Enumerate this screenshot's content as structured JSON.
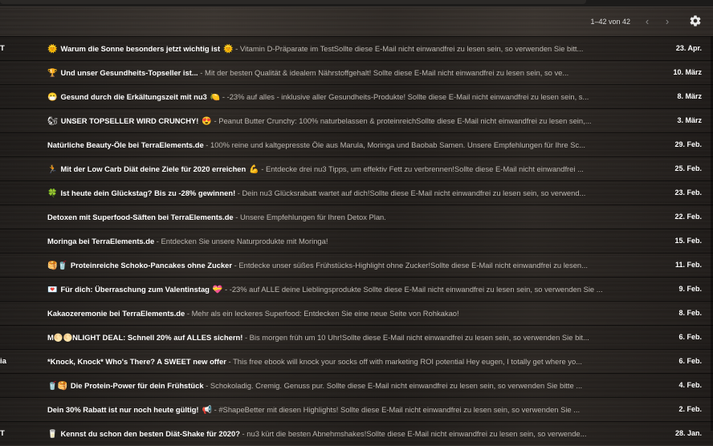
{
  "toolbar": {
    "pager": "1–42 von 42",
    "prev_icon": "chevron-left-icon",
    "next_icon": "chevron-right-icon",
    "settings_icon": "gear-icon"
  },
  "emails": [
    {
      "sender": "T",
      "e1": "🌞",
      "subject": "Warum die Sonne besonders jetzt wichtig ist",
      "e2": "🌞",
      "snippet": " - Vitamin D-Präparate im TestSollte diese E-Mail nicht einwandfrei zu lesen sein, so verwenden Sie bitt...",
      "date": "23. Apr."
    },
    {
      "sender": "",
      "e1": "🏆",
      "subject": "Und unser Gesundheits-Topseller ist...",
      "e2": "",
      "snippet": " - Mit der besten Qualität & idealem Nährstoffgehalt! Sollte diese E-Mail nicht einwandfrei zu lesen sein, so ve...",
      "date": "10. März"
    },
    {
      "sender": "",
      "e1": "😷",
      "subject": "Gesund durch die Erkältungszeit mit nu3",
      "e2": "🍋",
      "snippet": " - -23% auf alles - inklusive aller Gesundheits-Produkte! Sollte diese E-Mail nicht einwandfrei zu lesen sein, s...",
      "date": "8. März"
    },
    {
      "sender": "",
      "e1": "🐿",
      "subject": "UNSER TOPSELLER WIRD CRUNCHY!",
      "e2": "😍",
      "snippet": " - Peanut Butter Crunchy: 100% naturbelassen & proteinreichSollte diese E-Mail nicht einwandfrei zu lesen sein,...",
      "date": "3. März"
    },
    {
      "sender": "",
      "e1": "",
      "subject": "Natürliche Beauty-Öle bei TerraElements.de",
      "e2": "",
      "snippet": " - 100% reine und kaltgepresste Öle aus Marula, Moringa und Baobab Samen. Unsere Empfehlungen für Ihre Sc...",
      "date": "29. Feb."
    },
    {
      "sender": "",
      "e1": "🏃",
      "subject": "Mit der Low Carb Diät deine Ziele für 2020 erreichen",
      "e2": "💪",
      "snippet": " - Entdecke drei nu3 Tipps, um effektiv Fett zu verbrennen!Sollte diese E-Mail nicht einwandfrei ...",
      "date": "25. Feb."
    },
    {
      "sender": "",
      "e1": "🍀",
      "subject": "Ist heute dein Glückstag? Bis zu -28% gewinnen!",
      "e2": "",
      "snippet": " - Dein nu3 Glücksrabatt wartet auf dich!Sollte diese E-Mail nicht einwandfrei zu lesen sein, so verwend...",
      "date": "23. Feb."
    },
    {
      "sender": "",
      "e1": "",
      "subject": "Detoxen mit Superfood-Säften bei TerraElements.de",
      "e2": "",
      "snippet": " - Unsere Empfehlungen für Ihren Detox Plan.",
      "date": "22. Feb."
    },
    {
      "sender": "",
      "e1": "",
      "subject": "Moringa bei TerraElements.de",
      "e2": "",
      "snippet": " - Entdecken Sie unsere Naturprodukte mit Moringa!",
      "date": "15. Feb."
    },
    {
      "sender": "",
      "e1": "🥞🥤",
      "subject": "Proteinreiche Schoko-Pancakes ohne Zucker",
      "e2": "",
      "snippet": " - Entdecke unser süßes Frühstücks-Highlight ohne Zucker!Sollte diese E-Mail nicht einwandfrei zu lesen...",
      "date": "11. Feb."
    },
    {
      "sender": "",
      "e1": "💌",
      "subject": "Für dich: Überraschung zum Valentinstag",
      "e2": "💝",
      "snippet": " - -23% auf ALLE deine Lieblingsprodukte Sollte diese E-Mail nicht einwandfrei zu lesen sein, so verwenden Sie ...",
      "date": "9. Feb."
    },
    {
      "sender": "",
      "e1": "",
      "subject": "Kakaozeremonie bei TerraElements.de",
      "e2": "",
      "snippet": " - Mehr als ein leckeres Superfood: Entdecken Sie eine neue Seite von Rohkakao!",
      "date": "8. Feb."
    },
    {
      "sender": "",
      "e1": "",
      "subject": "M🌕🌕NLIGHT DEAL: Schnell 20% auf ALLES sichern!",
      "e2": "",
      "snippet": " - Bis morgen früh um 10 Uhr!Sollte diese E-Mail nicht einwandfrei zu lesen sein, so verwenden Sie bit...",
      "date": "6. Feb."
    },
    {
      "sender": "ia",
      "e1": "",
      "subject": "*Knock, Knock* Who's There? A SWEET new offer",
      "e2": "",
      "snippet": " - This free ebook will knock your socks off with marketing ROI potential Hey eugen, I totally get where yo...",
      "date": "6. Feb."
    },
    {
      "sender": "",
      "e1": "🥤🥞",
      "subject": "Die Protein-Power für dein Frühstück",
      "e2": "",
      "snippet": " - Schokoladig. Cremig. Genuss pur. Sollte diese E-Mail nicht einwandfrei zu lesen sein, so verwenden Sie bitte ...",
      "date": "4. Feb."
    },
    {
      "sender": "",
      "e1": "",
      "subject": "Dein 30% Rabatt ist nur noch heute gültig!",
      "e2": "📢",
      "snippet": " - #ShapeBetter mit diesen Highlights! Sollte diese E-Mail nicht einwandfrei zu lesen sein, so verwenden Sie ...",
      "date": "2. Feb."
    },
    {
      "sender": "T",
      "e1": "🥛",
      "subject": "Kennst du schon den besten Diät-Shake für 2020?",
      "e2": "",
      "snippet": " - nu3 kürt die besten Abnehmshakes!Sollte diese E-Mail nicht einwandfrei zu lesen sein, so verwende...",
      "date": "28. Jan."
    }
  ]
}
